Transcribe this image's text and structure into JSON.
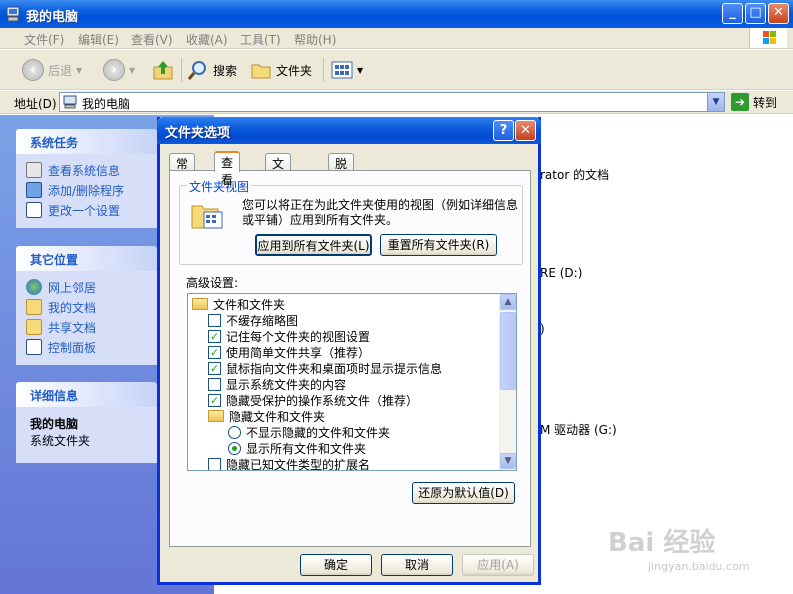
{
  "window": {
    "title": "我的电脑",
    "minimize": "_",
    "maximize": "□",
    "close": "✕"
  },
  "menu": [
    "文件(F)",
    "编辑(E)",
    "查看(V)",
    "收藏(A)",
    "工具(T)",
    "帮助(H)"
  ],
  "toolbar": {
    "back": "后退",
    "forward": "",
    "search": "搜索",
    "folders": "文件夹"
  },
  "address": {
    "label": "地址(D)",
    "value": "我的电脑",
    "go": "转到"
  },
  "taskpane": {
    "system_tasks": {
      "title": "系统任务",
      "items": [
        "查看系统信息",
        "添加/删除程序",
        "更改一个设置"
      ]
    },
    "other_places": {
      "title": "其它位置",
      "items": [
        "网上邻居",
        "我的文档",
        "共享文档",
        "控制面板"
      ]
    },
    "details": {
      "title": "详细信息",
      "name": "我的电脑",
      "sub": "系统文件夹"
    }
  },
  "content_partial": [
    "rator 的文档",
    "RE (D:)",
    ")",
    "M 驱动器 (G:)"
  ],
  "dialog": {
    "title": "文件夹选项",
    "help": "?",
    "close": "✕",
    "tabs": [
      "常规",
      "查看",
      "文件类型",
      "脱机文件"
    ],
    "active_tab": "查看",
    "folder_views": {
      "label": "文件夹视图",
      "description": "您可以将正在为此文件夹使用的视图（例如详细信息或平铺）应用到所有文件夹。",
      "apply_all": "应用到所有文件夹(L)",
      "reset_all": "重置所有文件夹(R)"
    },
    "advanced_label": "高级设置:",
    "tree": [
      {
        "type": "folder",
        "label": "文件和文件夹",
        "indent": 0
      },
      {
        "type": "check",
        "checked": false,
        "label": "不缓存缩略图",
        "indent": 1
      },
      {
        "type": "check",
        "checked": true,
        "label": "记住每个文件夹的视图设置",
        "indent": 1
      },
      {
        "type": "check",
        "checked": true,
        "label": "使用简单文件共享（推荐）",
        "indent": 1
      },
      {
        "type": "check",
        "checked": true,
        "label": "鼠标指向文件夹和桌面项时显示提示信息",
        "indent": 1
      },
      {
        "type": "check",
        "checked": false,
        "label": "显示系统文件夹的内容",
        "indent": 1
      },
      {
        "type": "check",
        "checked": true,
        "label": "隐藏受保护的操作系统文件（推荐）",
        "indent": 1
      },
      {
        "type": "folder",
        "label": "隐藏文件和文件夹",
        "indent": 1
      },
      {
        "type": "radio",
        "checked": false,
        "label": "不显示隐藏的文件和文件夹",
        "indent": 2
      },
      {
        "type": "radio",
        "checked": true,
        "label": "显示所有文件和文件夹",
        "indent": 2
      },
      {
        "type": "check",
        "checked": false,
        "label": "隐藏已知文件类型的扩展名",
        "indent": 1
      }
    ],
    "restore_defaults": "还原为默认值(D)",
    "ok": "确定",
    "cancel": "取消",
    "apply": "应用(A)"
  },
  "watermark": {
    "brand": "Bai 经验",
    "url": "jingyan.baidu.com"
  },
  "colors": {
    "xp_blue": "#0a5ee0",
    "task_pane": "#6375d6",
    "link_blue": "#215dc6",
    "dialog_bg": "#ece9d8"
  }
}
